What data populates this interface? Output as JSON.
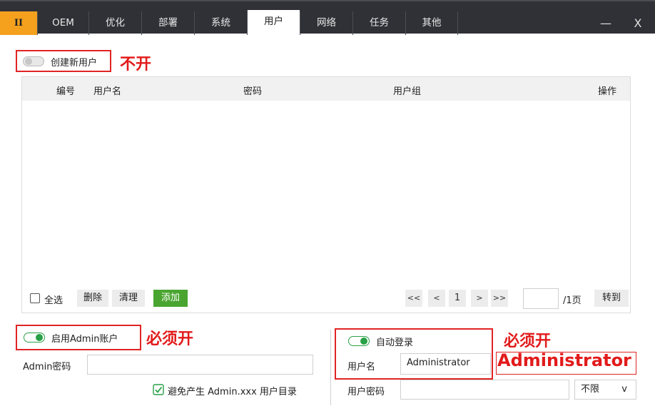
{
  "titlebar": {
    "logo": "II",
    "tabs": [
      "OEM",
      "优化",
      "部署",
      "系统",
      "用户",
      "网络",
      "任务",
      "其他"
    ],
    "active_tab": "用户",
    "minimize": "—",
    "close": "X"
  },
  "create_user": {
    "label": "创建新用户",
    "toggle_state": "off",
    "note": "不开"
  },
  "table": {
    "columns": [
      "编号",
      "用户名",
      "密码",
      "用户组",
      "操作"
    ],
    "rows": []
  },
  "actions": {
    "select_all": "全选",
    "delete": "删除",
    "clear": "清理",
    "add": "添加"
  },
  "pagination": {
    "first": "<<",
    "prev": "<",
    "page": "1",
    "next": ">",
    "last": ">>",
    "page_input": "",
    "total": "/1页",
    "goto": "转到"
  },
  "admin": {
    "toggle_label": "启用Admin账户",
    "toggle_state": "on",
    "note": "必须开",
    "password_label": "Admin密码",
    "password_value": "",
    "avoid_checkbox_label": "避免产生 Admin.xxx 用户目录"
  },
  "autologin": {
    "toggle_label": "自动登录",
    "toggle_state": "on",
    "note1": "必须开",
    "note2": "Administrator",
    "username_label": "用户名",
    "username_value": "Administrator",
    "password_label": "用户密码",
    "password_value": "",
    "limit_select": "不限",
    "limit_arrow": "v"
  },
  "colors": {
    "titlebar": "#2f3136",
    "logo": "#f5a11e",
    "annotation": "#e21b1b",
    "toggle_on": "#27a046",
    "add_button": "#4aa530"
  }
}
